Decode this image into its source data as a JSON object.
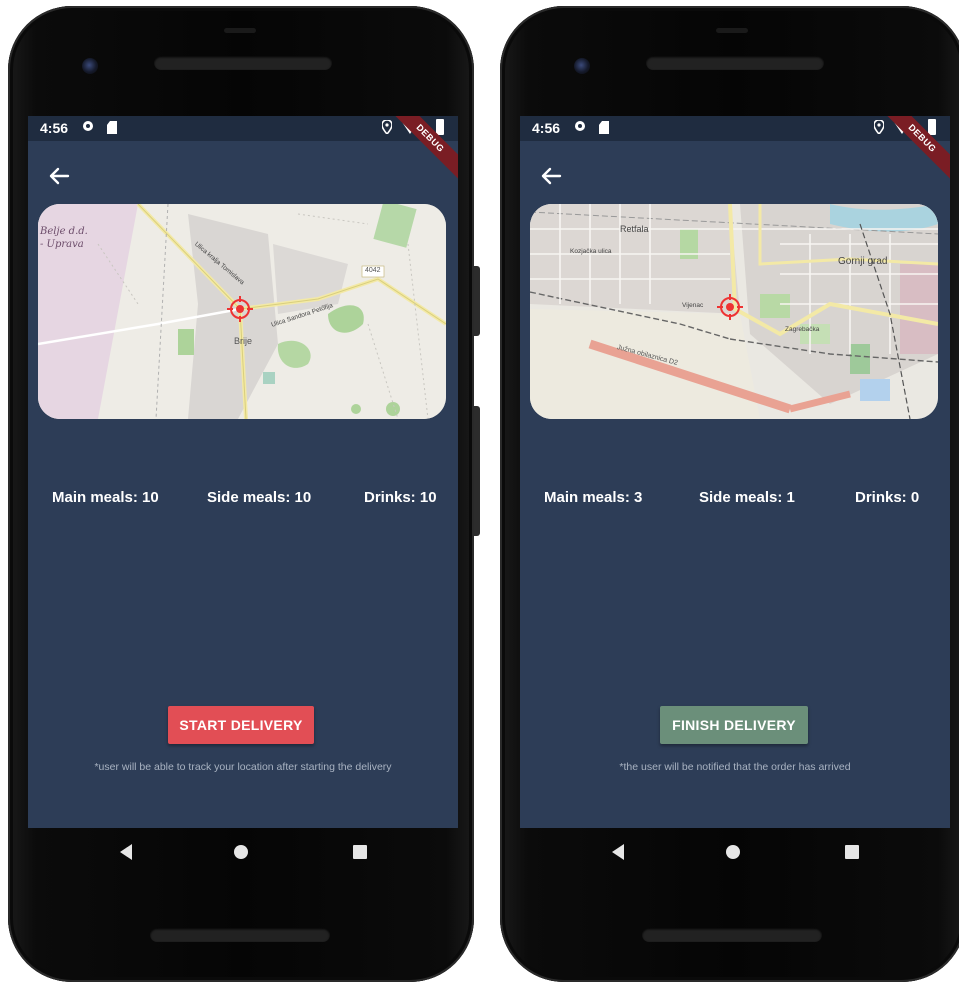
{
  "phones": [
    {
      "status": {
        "time": "4:56",
        "debug_label": "DEBUG"
      },
      "stats": {
        "main": "Main meals: 10",
        "side": "Side meals: 10",
        "drinks": "Drinks: 10"
      },
      "map_labels": {
        "a": "Belje d.d.",
        "b": "- Uprava",
        "c": "Brije",
        "d": "4042",
        "e": "Ulica Sandora Petőfija",
        "f": "Ulica kralja Tomislava"
      },
      "action": {
        "label": "START DELIVERY",
        "color": "#e24e55"
      },
      "note": "*user will be able to track your location after starting the delivery"
    },
    {
      "status": {
        "time": "4:56",
        "debug_label": "DEBUG"
      },
      "stats": {
        "main": "Main meals: 3",
        "side": "Side meals: 1",
        "drinks": "Drinks: 0"
      },
      "map_labels": {
        "a": "Retfala",
        "b": "Gornji grad",
        "c": "Južna obilaznica D2",
        "d": "Vijenac",
        "e": "Zagrebačka",
        "f": "Kozjačka ulica"
      },
      "action": {
        "label": "FINISH DELIVERY",
        "color": "#6b8f7a"
      },
      "note": "*the user will be notified that the order has arrived"
    }
  ]
}
